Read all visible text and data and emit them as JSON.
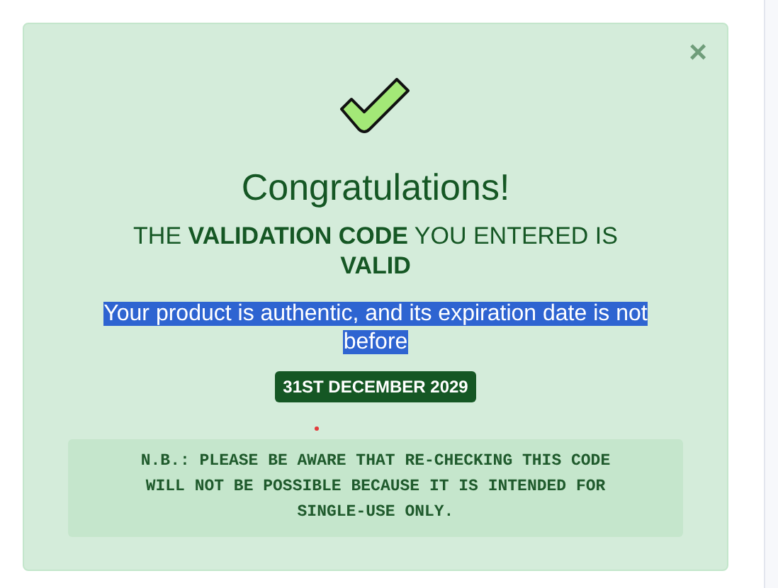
{
  "alert": {
    "close": "×",
    "title": "Congratulations!",
    "subtitle": "THE **VALIDATION CODE** YOU ENTERED IS **VALID**",
    "message": {
      "text": "Your product is authentic, and its expiration date is not before",
      "highlighted": true
    },
    "date_badge": "31ST DECEMBER 2029",
    "note": "N.B.: PLEASE BE AWARE THAT RE-CHECKING THIS CODE WILL NOT BE POSSIBLE BECAUSE IT IS INTENDED FOR SINGLE-USE ONLY."
  }
}
